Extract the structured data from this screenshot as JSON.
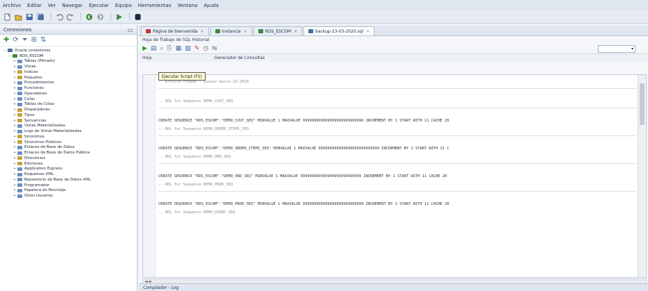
{
  "menu": [
    "Archivo",
    "Editar",
    "Ver",
    "Navegar",
    "Ejecutar",
    "Equipo",
    "Herramientas",
    "Ventana",
    "Ayuda"
  ],
  "toolbar_icons": [
    "new-icon",
    "open-icon",
    "save-icon",
    "save-all-icon",
    "undo-icon",
    "redo-icon",
    "back-icon",
    "forward-icon",
    "run-icon",
    "db-icon"
  ],
  "connections_panel": {
    "title": "Conexiones",
    "tools": [
      "add-connection-icon",
      "refresh-icon",
      "filter-icon",
      "schema-icon",
      "sync-icon"
    ],
    "tree": [
      {
        "label": "Oracle conexiones",
        "level": 0,
        "expander": "−",
        "color": "#4a6fa5"
      },
      {
        "label": "RDS_ESCOM",
        "level": 1,
        "expander": "−",
        "color": "#3c8a3c"
      },
      {
        "label": "Tablas (Filtrado)",
        "level": 2,
        "expander": "+",
        "color": "#6a8fc0"
      },
      {
        "label": "Vistas",
        "level": 2,
        "expander": "+",
        "color": "#6a8fc0"
      },
      {
        "label": "Índices",
        "level": 2,
        "expander": "+",
        "color": "#c7a13b"
      },
      {
        "label": "Paquetes",
        "level": 2,
        "expander": "+",
        "color": "#c7a13b"
      },
      {
        "label": "Procedimientos",
        "level": 2,
        "expander": "+",
        "color": "#6a8fc0"
      },
      {
        "label": "Funciones",
        "level": 2,
        "expander": "+",
        "color": "#6a8fc0"
      },
      {
        "label": "Operadores",
        "level": 2,
        "expander": "+",
        "color": "#6a8fc0"
      },
      {
        "label": "Colas",
        "level": 2,
        "expander": "+",
        "color": "#6a8fc0"
      },
      {
        "label": "Tablas de Colas",
        "level": 2,
        "expander": "+",
        "color": "#6a8fc0"
      },
      {
        "label": "Disparadores",
        "level": 2,
        "expander": "+",
        "color": "#c7a13b"
      },
      {
        "label": "Tipos",
        "level": 2,
        "expander": "+",
        "color": "#c7a13b"
      },
      {
        "label": "Secuencias",
        "level": 2,
        "expander": "+",
        "color": "#c7a13b"
      },
      {
        "label": "Vistas Materializadas",
        "level": 2,
        "expander": "+",
        "color": "#6a8fc0"
      },
      {
        "label": "Logs de Vistas Materializadas",
        "level": 2,
        "expander": "+",
        "color": "#6a8fc0"
      },
      {
        "label": "Sinónimos",
        "level": 2,
        "expander": "+",
        "color": "#c7a13b"
      },
      {
        "label": "Sinónimos Públicos",
        "level": 2,
        "expander": "+",
        "color": "#c7a13b"
      },
      {
        "label": "Enlaces de Base de Datos",
        "level": 2,
        "expander": "+",
        "color": "#6a8fc0"
      },
      {
        "label": "Enlaces de Base de Datos Pública",
        "level": 2,
        "expander": "+",
        "color": "#6a8fc0"
      },
      {
        "label": "Directorios",
        "level": 2,
        "expander": "+",
        "color": "#c7a13b"
      },
      {
        "label": "Ediciones",
        "level": 2,
        "expander": "+",
        "color": "#c7a13b"
      },
      {
        "label": "Application Express",
        "level": 2,
        "expander": "+",
        "color": "#6a8fc0"
      },
      {
        "label": "Esquemas XML",
        "level": 2,
        "expander": "+",
        "color": "#6a8fc0"
      },
      {
        "label": "Repositorio de Base de Datos XML",
        "level": 2,
        "expander": "+",
        "color": "#6a8fc0"
      },
      {
        "label": "Programador",
        "level": 2,
        "expander": "+",
        "color": "#6a8fc0"
      },
      {
        "label": "Papelera de Reciclaje",
        "level": 2,
        "expander": "+",
        "color": "#6a8fc0"
      },
      {
        "label": "Otros Usuarios",
        "level": 2,
        "expander": "+",
        "color": "#6a8fc0"
      }
    ]
  },
  "tabs": [
    {
      "label": "Página de bienvenida",
      "color": "#c0392b",
      "active": false
    },
    {
      "label": "Instancia",
      "color": "#3c8a3c",
      "active": false
    },
    {
      "label": "RDS_ESCOM",
      "color": "#3c8a3c",
      "active": false
    },
    {
      "label": "backup-23-03-2020.sql",
      "color": "#4a6fa5",
      "active": true
    }
  ],
  "worksheet": {
    "label": "Hoja de Trabajo de SQL  Historial",
    "tools": [
      "run-statement-icon",
      "run-script-icon",
      "explain-icon",
      "autotrace-icon",
      "commit-icon",
      "rollback-icon",
      "clear-icon",
      "history-icon",
      "format-icon"
    ],
    "connection": "",
    "tooltip": "Ejecutar Script (F5)",
    "subtabs": [
      "Hoja",
      "Generador de Consultas"
    ]
  },
  "code_lines": [
    {
      "kind": "comment",
      "text": "--  Archivo creado - jueves-marzo-23-2020"
    },
    {
      "kind": "sep",
      "text": ""
    },
    {
      "kind": "blank",
      "text": ""
    },
    {
      "kind": "comment",
      "text": "--  DDL for Sequence DEMO_CUST_SEQ"
    },
    {
      "kind": "sep",
      "text": ""
    },
    {
      "kind": "blank",
      "text": ""
    },
    {
      "kind": "code",
      "text": "   CREATE SEQUENCE  \"RDS_ESCOM\".\"DEMO_CUST_SEQ\"  MINVALUE 1 MAXVALUE 999999999999999999999999999 INCREMENT BY 1 START WITH 11 CACHE 20"
    },
    {
      "kind": "comment",
      "text": "--  DDL for Sequence DEMO_ORDER_ITEMS_SEQ"
    },
    {
      "kind": "sep",
      "text": ""
    },
    {
      "kind": "blank",
      "text": ""
    },
    {
      "kind": "code",
      "text": "   CREATE SEQUENCE  \"RDS_ESCOM\".\"DEMO_ORDER_ITEMS_SEQ\"  MINVALUE 1 MAXVALUE 999999999999999999999999999 INCREMENT BY 1 START WITH 21 C"
    },
    {
      "kind": "comment",
      "text": "--  DDL for Sequence DEMO_ORD_SEQ"
    },
    {
      "kind": "sep",
      "text": ""
    },
    {
      "kind": "blank",
      "text": ""
    },
    {
      "kind": "code",
      "text": "   CREATE SEQUENCE  \"RDS_ESCOM\".\"DEMO_ORD_SEQ\"  MINVALUE 1 MAXVALUE 999999999999999999999999999 INCREMENT BY 1 START WITH 11 CACHE 20"
    },
    {
      "kind": "comment",
      "text": "--  DDL for Sequence DEMO_PROD_SEQ"
    },
    {
      "kind": "sep",
      "text": ""
    },
    {
      "kind": "blank",
      "text": ""
    },
    {
      "kind": "code",
      "text": "   CREATE SEQUENCE  \"RDS_ESCOM\".\"DEMO_PROD_SEQ\"  MINVALUE 1 MAXVALUE 999999999999999999999999999 INCREMENT BY 1 START WITH 11 CACHE 20"
    },
    {
      "kind": "comment",
      "text": "--  DDL for Sequence DEMO_USERS_SEQ"
    }
  ],
  "scroll_label": "◄ ►",
  "bottom": {
    "title": "Compilador - Log"
  }
}
